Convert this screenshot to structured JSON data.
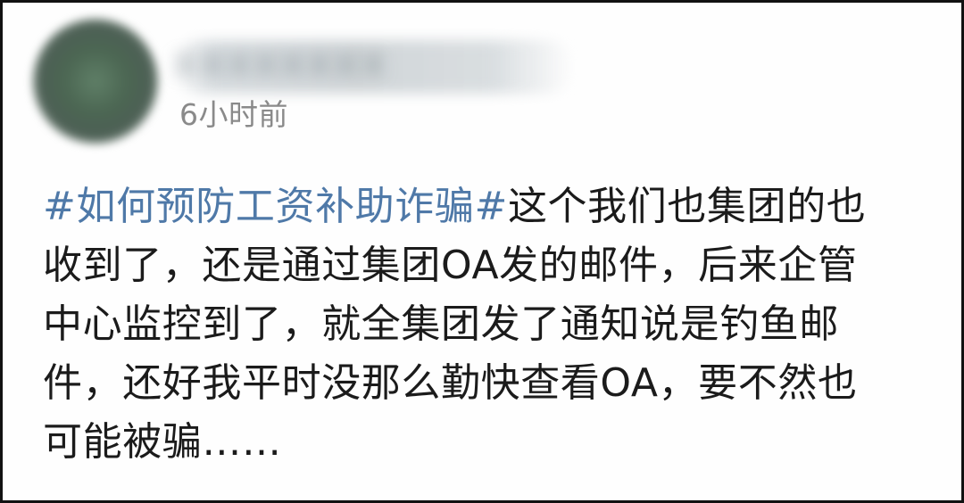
{
  "post": {
    "author_name": "某某某某某某某某",
    "timestamp": "6小时前",
    "hashtag": "#如何预防工资补助诈骗#",
    "lines": [
      "这个我们也集团的也",
      "收到了，还是通过集团OA发的邮件，后来企管",
      "中心监控到了，就全集团发了通知说是钓鱼邮",
      "件，还好我平时没那么勤快查看OA，要不然也",
      "可能被骗……"
    ]
  },
  "colors": {
    "hashtag": "#4f79a8",
    "body_text": "#1b1b1b",
    "timestamp": "#8a8a8a",
    "border": "#111111"
  }
}
